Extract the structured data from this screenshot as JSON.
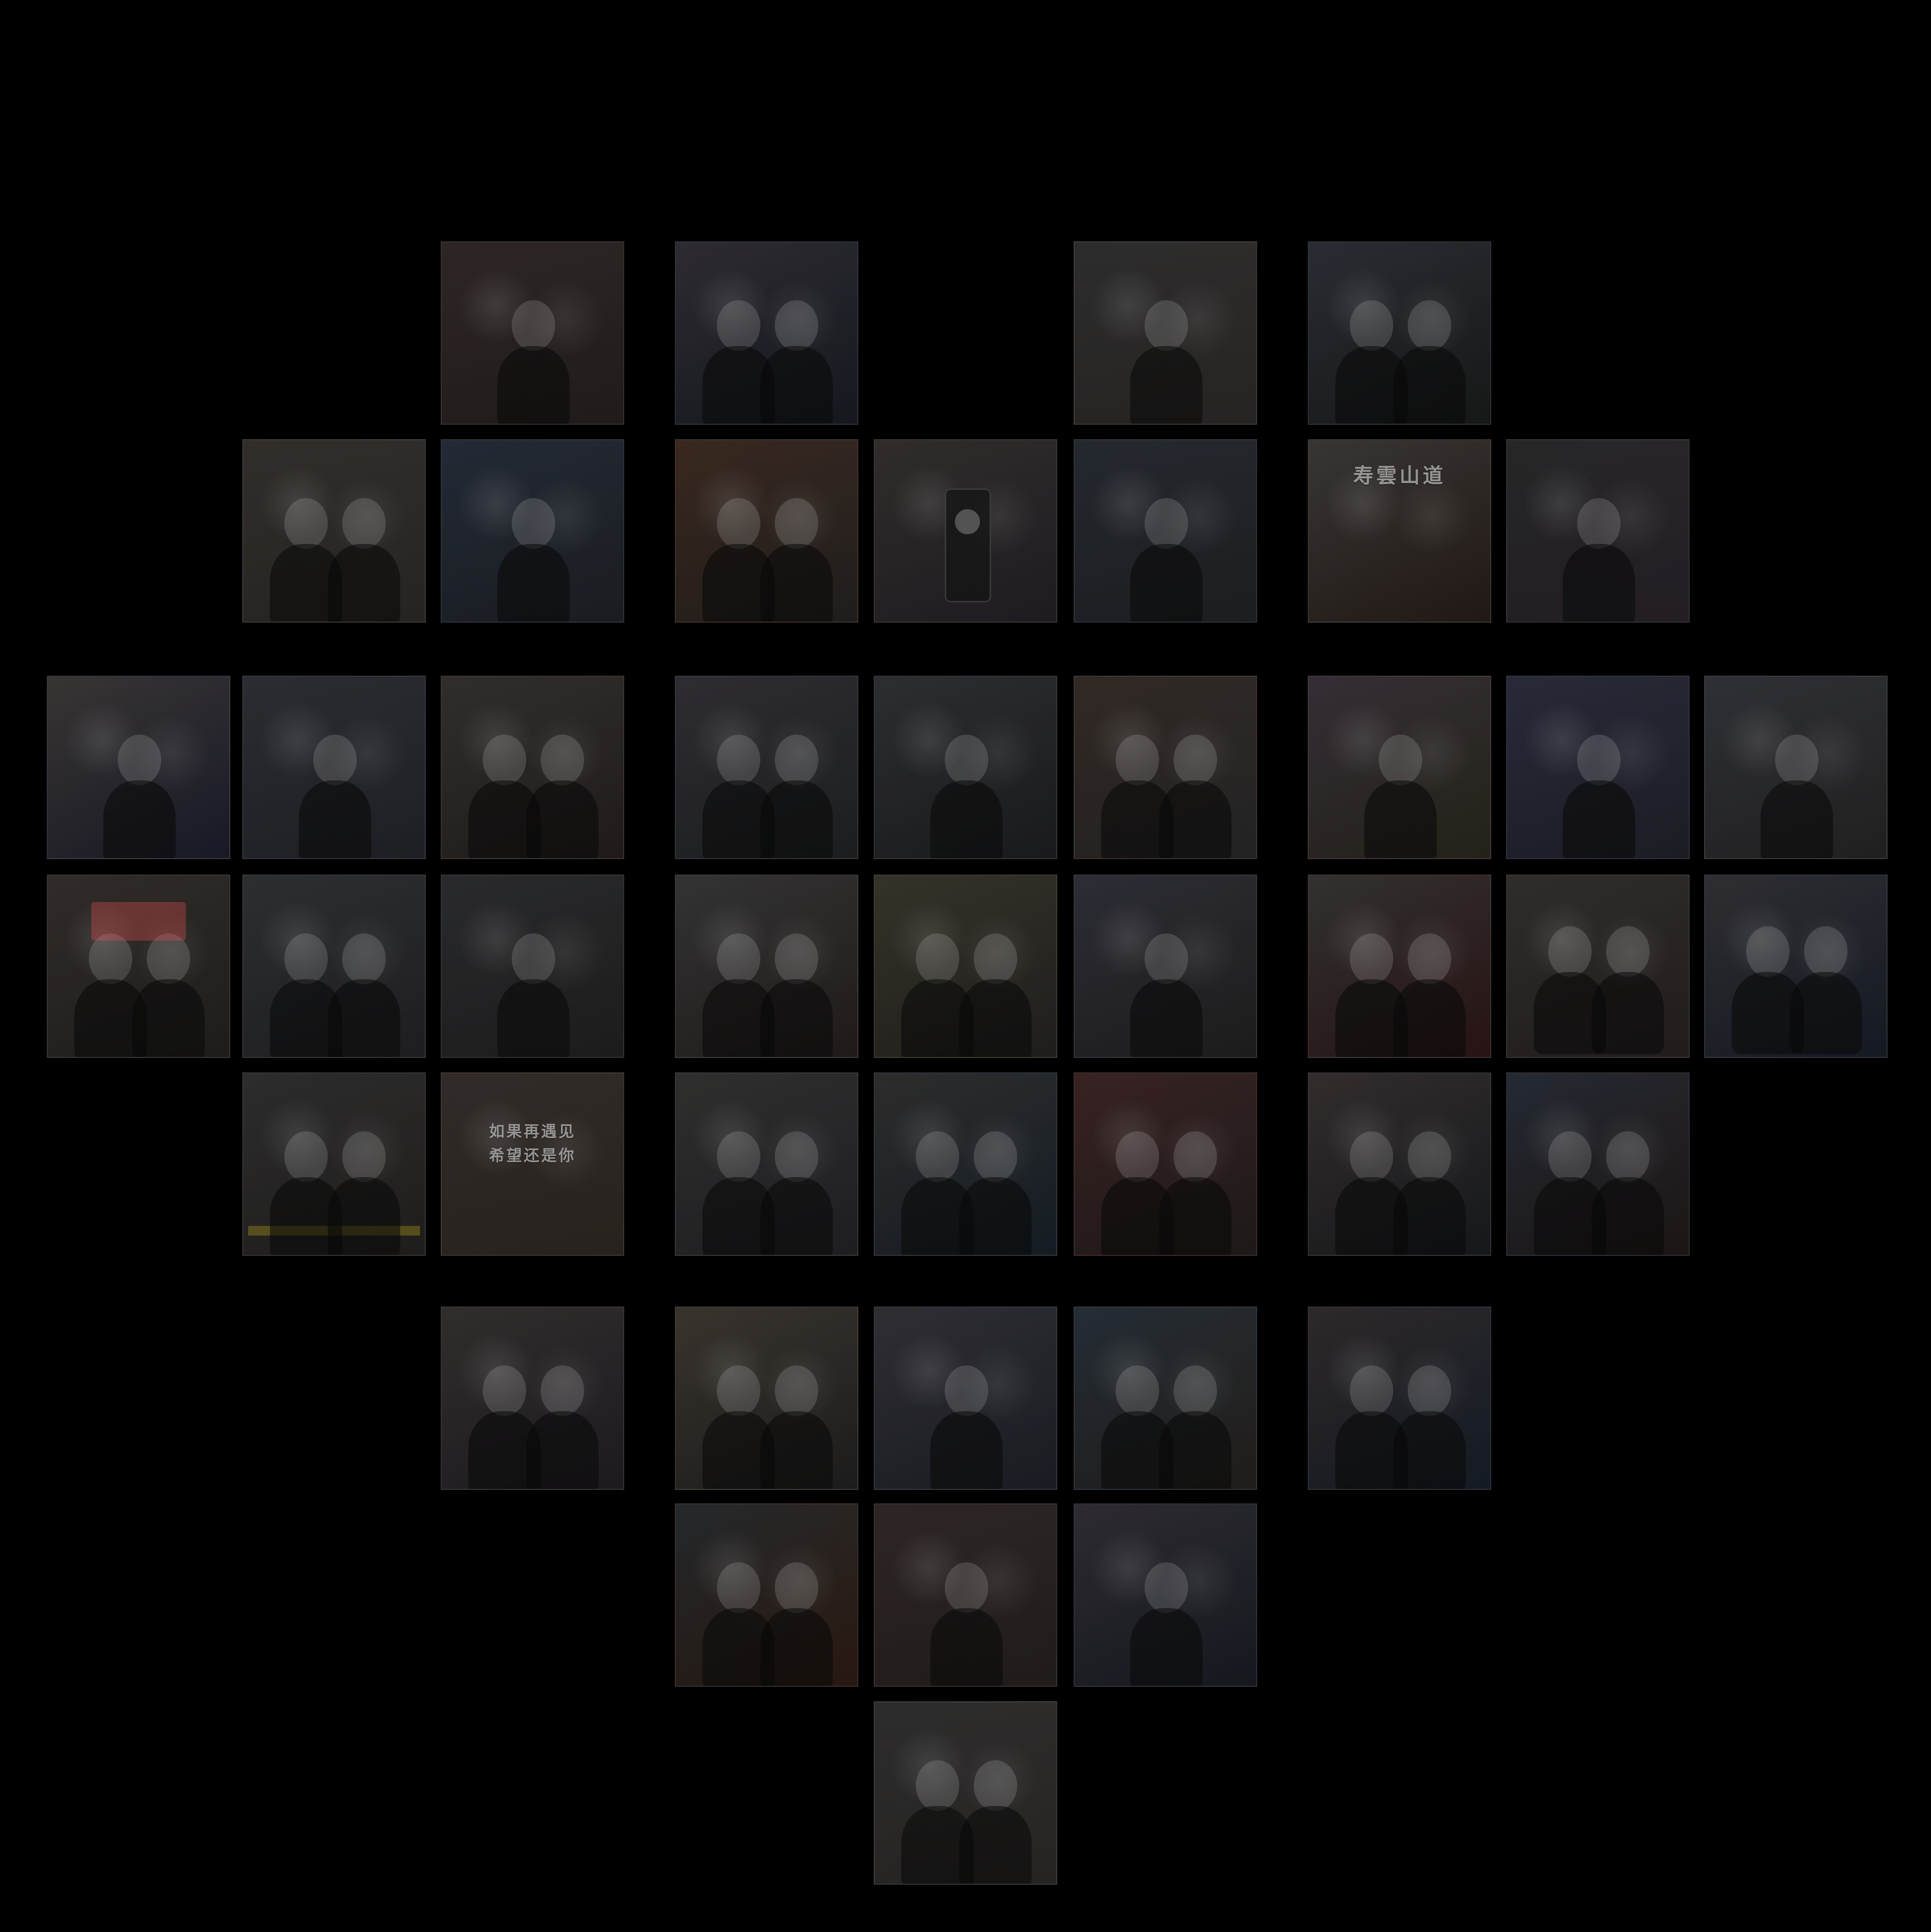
{
  "collage": {
    "background": "#000000",
    "tile_palette": [
      "#2b211f",
      "#2c2830",
      "#2b2a2a",
      "#262a33",
      "#302b27",
      "#1e2736",
      "#3b2418",
      "#302a28",
      "#1f252e",
      "#393634",
      "#222323",
      "#393532",
      "#272a30",
      "#2f2c2a",
      "#2d2a31",
      "#2a2c2f",
      "#31251f",
      "#352c37",
      "#25263a",
      "#2d2f36",
      "#302926",
      "#292d2e",
      "#26272a",
      "#333334",
      "#353224",
      "#2a2b36",
      "#313030",
      "#2d2b28",
      "#2d2c31",
      "#2a2a2a",
      "#302826",
      "#2e2d2b",
      "#2b2a29",
      "#3a1d1d",
      "#332a2a",
      "#1f2633",
      "#2f2b29",
      "#3a332b",
      "#2d2c33",
      "#1f2a35",
      "#2c2525",
      "#202529"
    ],
    "text_tiles": {
      "mountain_sign": "寿雲山道",
      "wall_quote_line1": "如果再遇见",
      "wall_quote_line2": "希望还是你"
    }
  }
}
